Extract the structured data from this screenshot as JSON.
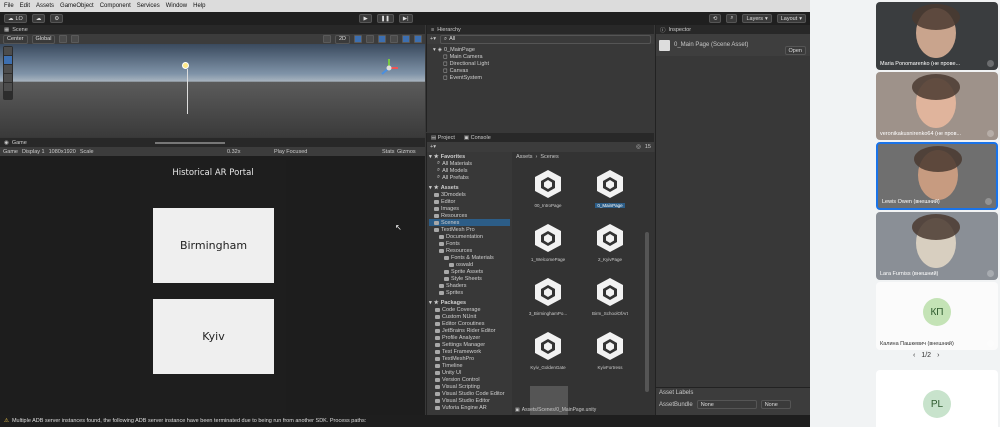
{
  "menu": [
    "File",
    "Edit",
    "Assets",
    "GameObject",
    "Component",
    "Services",
    "Window",
    "Help"
  ],
  "toolbar": {
    "account": "LO",
    "play_icon": "play-icon",
    "pause_icon": "pause-icon",
    "step_icon": "step-icon",
    "layers": "Layers",
    "layout": "Layout"
  },
  "scene": {
    "tab": "Scene",
    "pivot": "Center",
    "space": "Global",
    "gizmo_label": "2D"
  },
  "game": {
    "tab": "Game",
    "mode": "Game",
    "display": "Display 1",
    "resolution": "1080x1920",
    "scale_label": "Scale",
    "scale_value": "0.32x",
    "play_focused": "Play Focused",
    "stats": "Stats",
    "gizmos": "Gizmos",
    "canvas_title": "Historical AR Portal",
    "card1": "Birmingham",
    "card2": "Kyiv"
  },
  "hierarchy": {
    "tab": "Hierarchy",
    "search_placeholder": "All",
    "root": "0_MainPage",
    "children": [
      "Main Camera",
      "Directional Light",
      "Canvas",
      "EventSystem"
    ]
  },
  "inspector": {
    "tab": "Inspector",
    "title": "0_Main Page (Scene Asset)",
    "open_button": "Open",
    "asset_labels": "Asset Labels",
    "asset_bundle": "AssetBundle",
    "none1": "None",
    "none2": "None"
  },
  "project": {
    "tab_project": "Project",
    "tab_console": "Console",
    "count": "15",
    "favorites": {
      "label": "Favorites",
      "items": [
        "All Materials",
        "All Models",
        "All Prefabs"
      ]
    },
    "assets": {
      "label": "Assets",
      "items": [
        {
          "name": "3Dmodels",
          "indent": 1
        },
        {
          "name": "Editor",
          "indent": 1
        },
        {
          "name": "Images",
          "indent": 1
        },
        {
          "name": "Resources",
          "indent": 1
        },
        {
          "name": "Scenes",
          "indent": 1,
          "selected": true
        },
        {
          "name": "TextMesh Pro",
          "indent": 1
        },
        {
          "name": "Documentation",
          "indent": 2
        },
        {
          "name": "Fonts",
          "indent": 2
        },
        {
          "name": "Resources",
          "indent": 2
        },
        {
          "name": "Fonts & Materials",
          "indent": 3
        },
        {
          "name": "oswald",
          "indent": 4
        },
        {
          "name": "Sprite Assets",
          "indent": 3
        },
        {
          "name": "Style Sheets",
          "indent": 3
        },
        {
          "name": "Shaders",
          "indent": 2
        },
        {
          "name": "Sprites",
          "indent": 2
        }
      ]
    },
    "packages": {
      "label": "Packages",
      "items": [
        "Code Coverage",
        "Custom NUnit",
        "Editor Coroutines",
        "JetBrains Rider Editor",
        "Profile Analyzer",
        "Settings Manager",
        "Test Framework",
        "TextMeshPro",
        "Timeline",
        "Unity UI",
        "Version Control",
        "Visual Scripting",
        "Visual Studio Code Editor",
        "Visual Studio Editor",
        "Vuforia Engine AR"
      ]
    },
    "breadcrumb": [
      "Assets",
      "Scenes"
    ],
    "grid_items": [
      {
        "label": "00_IntroPage",
        "selected": false
      },
      {
        "label": "0_MainPage",
        "selected": true
      },
      {
        "label": "1_WelcomePage",
        "selected": false
      },
      {
        "label": "2_KyivPage",
        "selected": false
      },
      {
        "label": "3_BirminghamPo...",
        "selected": false
      },
      {
        "label": "Birm_SchoolOfArt",
        "selected": false
      },
      {
        "label": "Kyiv_GoldenGate",
        "selected": false
      },
      {
        "label": "KyivFortress",
        "selected": false
      }
    ],
    "path": "Assets/Scenes/0_MainPage.unity"
  },
  "status": "Multiple ADB server instances found, the following ADB server instance have been terminated due to being run from another SDK. Process paths:",
  "participants": [
    {
      "name": "Maria Ponomarenko (не провe...",
      "bg": "#3a3d3f",
      "face": "#c9a48d"
    },
    {
      "name": "veronikakusnirenko64 (не пров...",
      "bg": "#9e928a",
      "face": "#e0b49c"
    },
    {
      "name": "Lewis Owen (внешний)",
      "bg": "#6f6f6f",
      "face": "#c79b80"
    },
    {
      "name": "Lara Furniss (внешний)",
      "bg": "#8a8f96",
      "face": "#d8cfc0"
    },
    {
      "name": "Калина Пашкевич (внешний)",
      "initials": "КП",
      "avatar_color": "#c4e3b6"
    },
    {
      "initials": "PL",
      "avatar_color": "#c8e3cc"
    }
  ],
  "pagination": "1/2",
  "colors": {
    "accent": "#1a73e8",
    "selection": "#2c5d87",
    "unity_dark": "#383838"
  }
}
